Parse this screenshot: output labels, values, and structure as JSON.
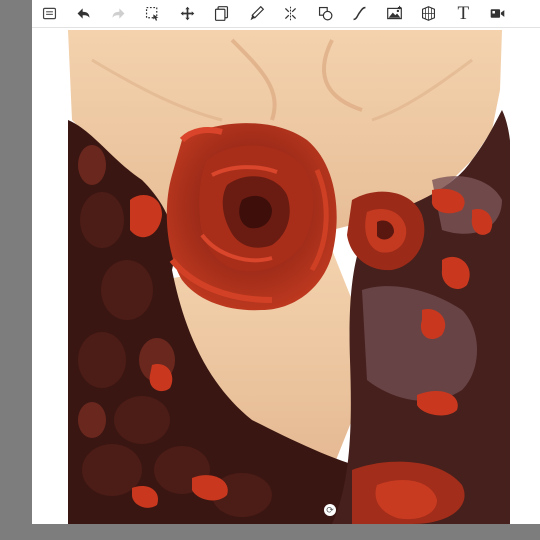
{
  "app": {
    "colors": {
      "workspace_bg": "#7d7d7d",
      "canvas_bg": "#ffffff",
      "toolbar_bg": "#ffffff",
      "icon_color": "#333333"
    }
  },
  "toolbar": {
    "tools": [
      {
        "icon": "menu-icon",
        "enabled": true
      },
      {
        "icon": "undo-icon",
        "enabled": true
      },
      {
        "icon": "redo-icon",
        "enabled": false
      },
      {
        "icon": "selection-icon",
        "enabled": true
      },
      {
        "icon": "move-icon",
        "enabled": true
      },
      {
        "icon": "layers-icon",
        "enabled": true
      },
      {
        "icon": "brush-icon",
        "enabled": true
      },
      {
        "icon": "symmetry-icon",
        "enabled": true
      },
      {
        "icon": "shapes-icon",
        "enabled": true
      },
      {
        "icon": "curve-ruler-icon",
        "enabled": true
      },
      {
        "icon": "image-icon",
        "enabled": true
      },
      {
        "icon": "perspective-icon",
        "enabled": true
      },
      {
        "icon": "text-icon",
        "label": "T",
        "enabled": true
      },
      {
        "icon": "video-icon",
        "enabled": true
      }
    ]
  },
  "canvas": {
    "artwork": "rose-painting",
    "handle_icon": "rotate-handle-icon",
    "handle_glyph": "⟳",
    "colors": {
      "skin": "#ecc9a0",
      "rose_red": "#b8321c",
      "bright_red": "#d63d1f",
      "dark": "#3a1612",
      "shadow": "#5a2a26"
    }
  }
}
